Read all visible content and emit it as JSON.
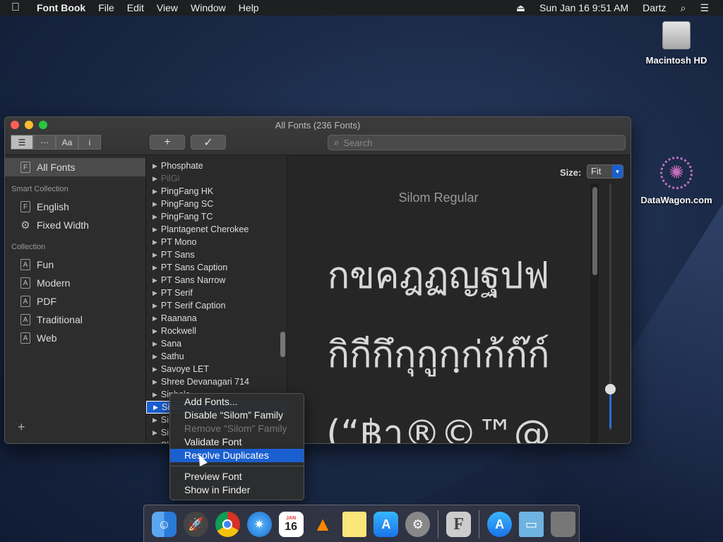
{
  "menubar": {
    "app": "Font Book",
    "menus": [
      "File",
      "Edit",
      "View",
      "Window",
      "Help"
    ],
    "datetime": "Sun Jan 16  9:51 AM",
    "user": "Dartz"
  },
  "desktop": {
    "hd_label": "Macintosh HD",
    "web_label": "DataWagon.com"
  },
  "window": {
    "title": "All Fonts (236 Fonts)",
    "search_placeholder": "Search",
    "add_symbol": "+",
    "validate_symbol": "✓",
    "view_seg": [
      "☰",
      "⋯",
      "Aa",
      "i"
    ]
  },
  "sidebar": {
    "all_fonts": "All Fonts",
    "smart_header": "Smart Collection",
    "smart_items": [
      "English",
      "Fixed Width"
    ],
    "collection_header": "Collection",
    "collection_items": [
      "Fun",
      "Modern",
      "PDF",
      "Traditional",
      "Web"
    ],
    "add_symbol": "+"
  },
  "fontlist": {
    "items": [
      "Phosphate",
      "PilGi",
      "PingFang HK",
      "PingFang SC",
      "PingFang TC",
      "Plantagenet Cherokee",
      "PT Mono",
      "PT Sans",
      "PT Sans Caption",
      "PT Sans Narrow",
      "PT Serif",
      "PT Serif Caption",
      "Raanana",
      "Rockwell",
      "Sana",
      "Sathu",
      "Savoye LET",
      "Shree Devanagari 714",
      "Sinhala",
      "Silom",
      "Si",
      "Si",
      "Sk"
    ]
  },
  "preview": {
    "size_label": "Size:",
    "size_value": "Fit",
    "font_name": "Silom Regular",
    "sample1": "กขคฎฏญฐปฟ",
    "sample2": "กิกีกึกุกูกฺก่ก้ก๊ก์",
    "sample3": "(“฿า®©™@"
  },
  "context_menu": {
    "items": [
      "Add Fonts...",
      "Disable “Silom” Family",
      "Remove “Silom” Family",
      "Validate Font",
      "Resolve Duplicates",
      "Preview Font",
      "Show in Finder"
    ]
  },
  "dock": {
    "calendar_month": "JAN",
    "calendar_day": "16",
    "fontbook_letter": "F"
  },
  "colors": {
    "accent": "#1a5fd0",
    "window_bg": "#2b2b2b"
  }
}
